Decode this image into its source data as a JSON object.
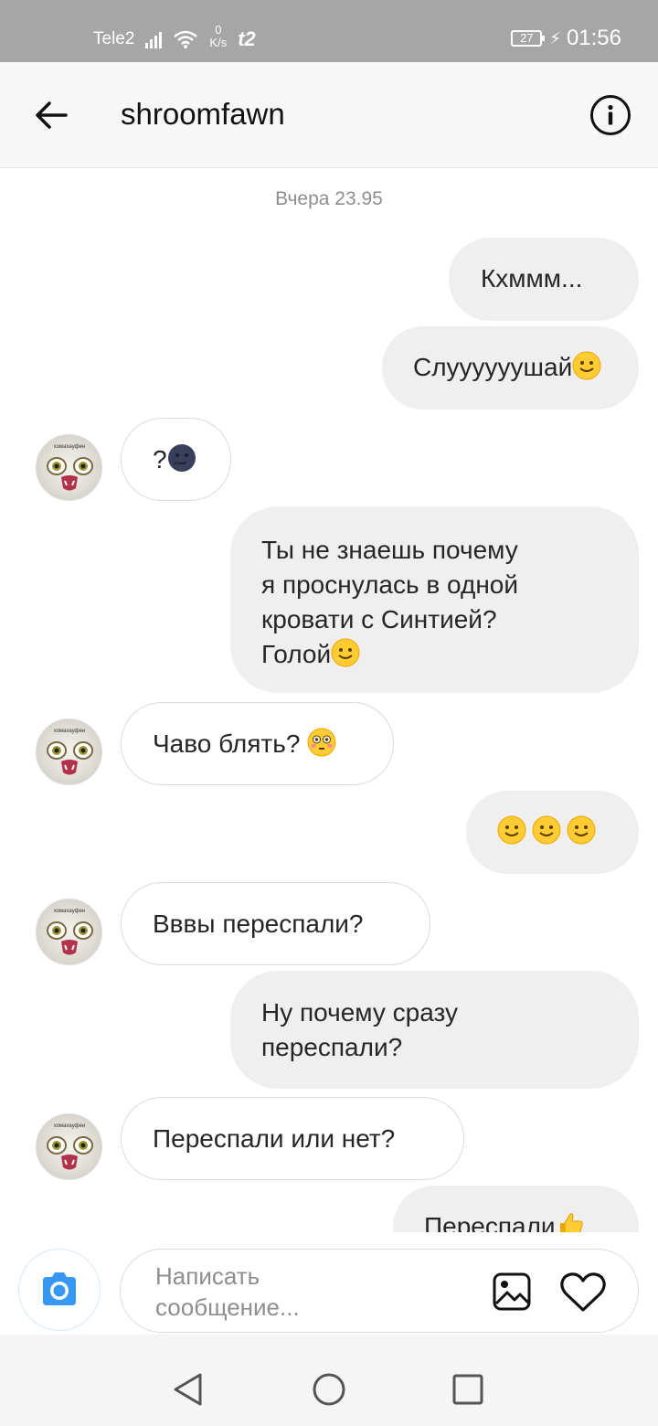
{
  "status_bar": {
    "carrier": "Tele2",
    "speed_value": "0",
    "speed_unit": "K/s",
    "operator_logo": "t2",
    "battery": "27",
    "time": "01:56"
  },
  "header": {
    "title": "shroomfawn"
  },
  "conversation": {
    "date": "Вчера 23.95",
    "messages": [
      {
        "dir": "out",
        "text": "Кхммм...",
        "emoji": ""
      },
      {
        "dir": "out",
        "text": "Слуууууушай",
        "emoji": "slightly-smiling-face"
      },
      {
        "dir": "in",
        "text": "?",
        "emoji": "new-moon-face"
      },
      {
        "dir": "out",
        "lines": [
          "Ты не знаешь почему",
          "я проснулась в одной",
          "кровати с Синтией?",
          "Голой"
        ],
        "emoji": "slightly-smiling-face"
      },
      {
        "dir": "in",
        "text": "Чаво блять? ",
        "emoji": "flushed-face"
      },
      {
        "dir": "out",
        "text": "",
        "emoji": "slightly-smiling-face x3"
      },
      {
        "dir": "in",
        "text": "Вввы переспали?",
        "emoji": ""
      },
      {
        "dir": "out",
        "lines": [
          "Ну почему сразу",
          "переспали?"
        ],
        "emoji": ""
      },
      {
        "dir": "in",
        "text": "Переспали или нет?",
        "emoji": ""
      },
      {
        "dir": "out",
        "text": "Переспали",
        "emoji": "thumbs-up"
      }
    ],
    "avatar_caption": "хомахауфен"
  },
  "composer": {
    "placeholder_line1": "Написать",
    "placeholder_line2": "сообщение..."
  },
  "colors": {
    "status_bar": "#a6a6a6",
    "outgoing_bubble": "#efefef",
    "camera_accent": "#3897f0"
  }
}
